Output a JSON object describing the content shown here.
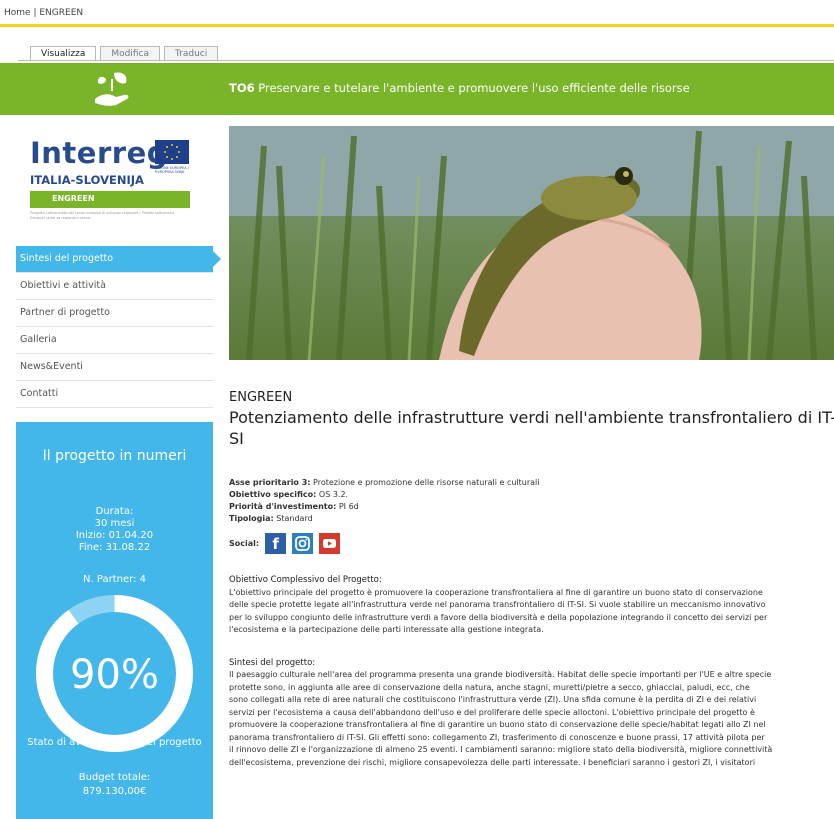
{
  "breadcrumb": {
    "home": "Home",
    "sep": "|",
    "current": "ENGREEN"
  },
  "tabs": [
    {
      "label": "Visualizza"
    },
    {
      "label": "Modifica"
    },
    {
      "label": "Traduci"
    }
  ],
  "banner": {
    "code": "TO6",
    "text": "Preservare e tutelare l'ambiente e promuovere l'uso efficiente delle risorse"
  },
  "logo": {
    "title": "Interreg",
    "subtitle": "ITALIA-SLOVENIJA",
    "project": "ENGREEN",
    "eu_text": "UNIONE EUROPEA / EVROPSKA UNIJA",
    "small_text": "Progetto cofinanziato dal Fondo europeo di sviluppo regionale / Projekt sofinancira Evropski sklad za regionalni razvoj"
  },
  "nav": [
    {
      "label": "Sintesi del progetto",
      "active": true
    },
    {
      "label": "Obiettivi e attività"
    },
    {
      "label": "Partner di progetto"
    },
    {
      "label": "Galleria"
    },
    {
      "label": "News&Eventi"
    },
    {
      "label": "Contatti"
    }
  ],
  "stats": {
    "heading": "Il progetto in numeri",
    "durata_label": "Durata:",
    "durata_value": "30 mesi",
    "inizio": "Inizio: 01.04.20",
    "fine": "Fine: 31.08.22",
    "partner": "N. Partner: 4",
    "percent": "90%",
    "progress": 0.9,
    "stato": "Stato di avanzamento del progetto",
    "budget_label": "Budget totale:",
    "budget_value": "879.130,00€"
  },
  "content": {
    "project": "ENGREEN",
    "title": "Potenziamento delle infrastrutture verdi nell'ambiente transfrontaliero di IT-SI",
    "asse_label": "Asse prioritario 3:",
    "asse_value": "Protezione e promozione delle risorse naturali e culturali",
    "obiettivo_label": "Obiettivo specifico:",
    "obiettivo_value": "OS 3.2.",
    "priorita_label": "Priorità d'investimento:",
    "priorita_value": "PI 6d",
    "tipologia_label": "Tipologia:",
    "tipologia_value": "Standard",
    "social_label": "Social:",
    "obj_heading": "Obiettivo Complessivo del Progetto:",
    "obj_lines": [
      "L'obiettivo principale del progetto è promuovere la cooperazione transfrontaliera al fine di garantire un buono stato di conservazione",
      "delle specie protette legate all'infrastruttura verde nel panorama transfrontaliero di IT-SI. Si vuole stabilire un meccanismo innovativo",
      "per lo sviluppo congiunto delle infrastrutture verdi a favore della biodiversità e della popolazione integrando il concetto dei servizi per",
      "l'ecosistema e la partecipazione delle parti interessate alla gestione integrata."
    ],
    "sint_heading": "Sintesi del progetto:",
    "sint_lines": [
      "Il paesaggio culturale nell'area del programma presenta una grande biodiversità. Habitat delle specie importanti per l'UE e altre specie",
      "protette sono, in aggiunta alle aree di conservazione della natura, anche stagni, muretti/pietre a secco, ghiacciai, paludi, ecc, che",
      "sono collegati alla rete di aree naturali che costituiscono l'infrastruttura verde (ZI). Una sfida comune è la perdita di ZI e dei relativi",
      "servizi per l'ecosistema a causa dell'abbandono dell'uso e del proliferare delle specie alloctoni. L'obiettivo principale del progetto è",
      "promuovere la cooperazione transfrontaliera al fine di garantire un buono stato di conservazione delle specie/habitat legati allo ZI nel",
      "panorama transfrontaliero di IT-SI. Gli effetti sono: collegamento ZI, trasferimento di conoscenze e buone prassi, 17 attività pilota per",
      "il rinnovo delle ZI e l'organizzazione di almeno 25 eventi. I cambiamenti saranno: migliore stato della biodiversità, migliore connettività",
      "dell'ecosistema, prevenzione dei rischi, migliore consapevolezza delle parti interessate. I beneficiari saranno i gestori ZI, i visitatori"
    ]
  },
  "icons": {
    "leaf_hand": "hand-leaf-icon",
    "facebook": "facebook-icon",
    "instagram": "instagram-icon",
    "youtube": "youtube-icon"
  },
  "colors": {
    "accent": "#43b7ea",
    "green": "#7ab428",
    "yellow": "#f2d31b",
    "navy": "#274b8b",
    "facebook": "#2f5ea8",
    "instagram": "#2f7fc0",
    "youtube": "#d23b2e"
  }
}
